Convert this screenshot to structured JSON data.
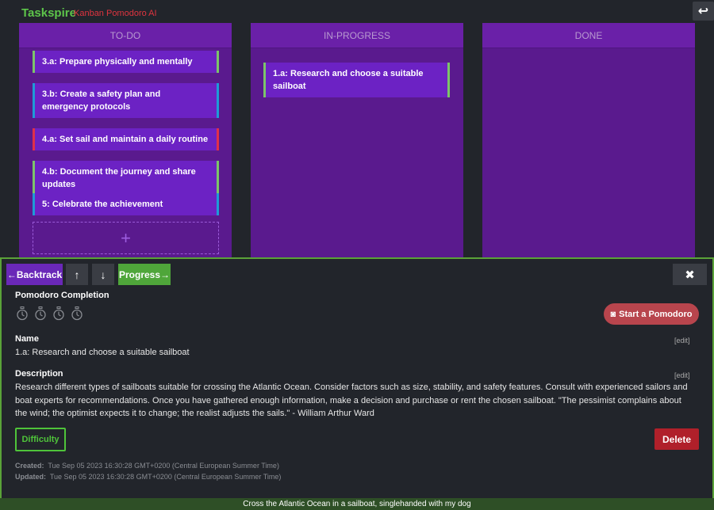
{
  "header": {
    "brand": "Taskspire",
    "subtitle": "Kanban Pomodoro AI",
    "back_icon": "↩"
  },
  "columns": [
    {
      "title": "TO-DO"
    },
    {
      "title": "IN-PROGRESS"
    },
    {
      "title": "DONE"
    }
  ],
  "todo_cards": [
    {
      "label": "3.a: Prepare physically and mentally",
      "color": "#7cc46a"
    },
    {
      "label": "3.b: Create a safety plan and emergency protocols",
      "color": "#1e9bd7"
    },
    {
      "label": "4.a: Set sail and maintain a daily routine",
      "color": "#e0304a"
    },
    {
      "label": "4.b: Document the journey and share updates",
      "color": "#7cc46a"
    },
    {
      "label": "5: Celebrate the achievement",
      "color": "#1e9bd7"
    }
  ],
  "add_card_symbol": "+",
  "progress_cards": [
    {
      "label": "1.a: Research and choose a suitable sailboat",
      "color": "#7cc46a"
    }
  ],
  "toolbar": {
    "backtrack": "←Backtrack",
    "up": "↑",
    "down": "↓",
    "progress": "Progress→",
    "close": "✖"
  },
  "detail": {
    "pomodoro_label": "Pomodoro Completion",
    "pomodoro_total": 4,
    "pomodoro_completed": 0,
    "start_pomodoro": "Start a Pomodoro",
    "start_icon": "◙",
    "name_label": "Name",
    "name_value": "1.a: Research and choose a suitable sailboat",
    "edit_label": "[edit]",
    "description_label": "Description",
    "description_value": "Research different types of sailboats suitable for crossing the Atlantic Ocean. Consider factors such as size, stability, and safety features. Consult with experienced sailors and boat experts for recommendations. Once you have gathered enough information, make a decision and purchase or rent the chosen sailboat. \"The pessimist complains about the wind; the optimist expects it to change; the realist adjusts the sails.\" - William Arthur Ward",
    "difficulty": "Difficulty",
    "delete": "Delete",
    "created_label": "Created:",
    "created_value": "Tue Sep 05 2023 16:30:28 GMT+0200 (Central European Summer Time)",
    "updated_label": "Updated:",
    "updated_value": "Tue Sep 05 2023 16:30:28 GMT+0200 (Central European Summer Time)"
  },
  "footer": {
    "goal": "Cross the Atlantic Ocean in a sailboat, singlehanded with my dog"
  }
}
